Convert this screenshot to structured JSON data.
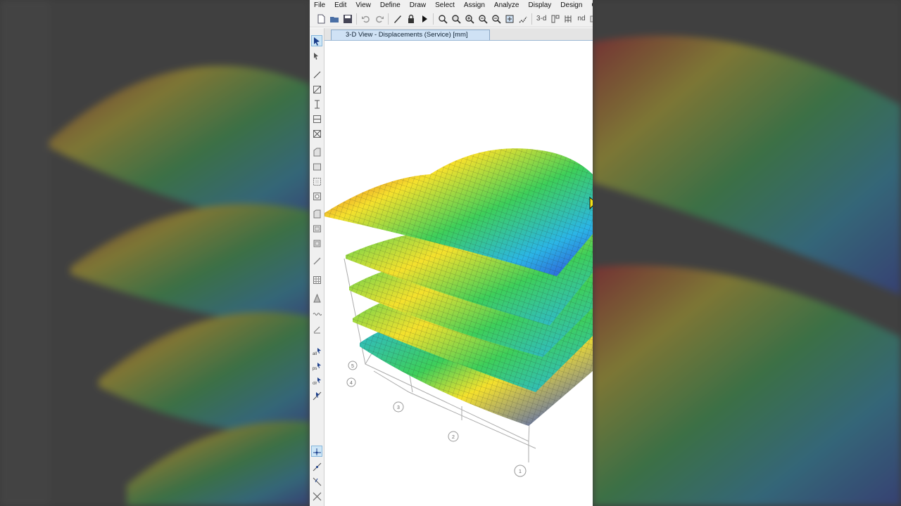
{
  "menu": [
    "File",
    "Edit",
    "View",
    "Define",
    "Draw",
    "Select",
    "Assign",
    "Analyze",
    "Display",
    "Design",
    "Op"
  ],
  "toolbar": {
    "text_3d": "3-d",
    "text_nd": "nd",
    "icons": [
      "new-model-icon",
      "open-icon",
      "save-icon",
      "undo-icon",
      "redo-icon",
      "refresh-icon",
      "lock-icon",
      "run-icon",
      "zoom-window-icon",
      "zoom-restore-icon",
      "zoom-in-icon",
      "zoom-out-icon",
      "zoom-previous-icon",
      "pan-icon",
      "rubber-band-icon"
    ]
  },
  "tab": {
    "title": "3-D View  - Displacements (Service)  [mm]"
  },
  "grid_bubbles": [
    "5",
    "4",
    "3",
    "2",
    "1"
  ],
  "colors": {
    "max": "#d9232a",
    "high": "#f5e12c",
    "mid": "#3ecf5a",
    "low": "#2bb5e6",
    "min": "#2f4bd6",
    "chrome": "#f0f0f0",
    "tab": "#cfe2f5"
  }
}
